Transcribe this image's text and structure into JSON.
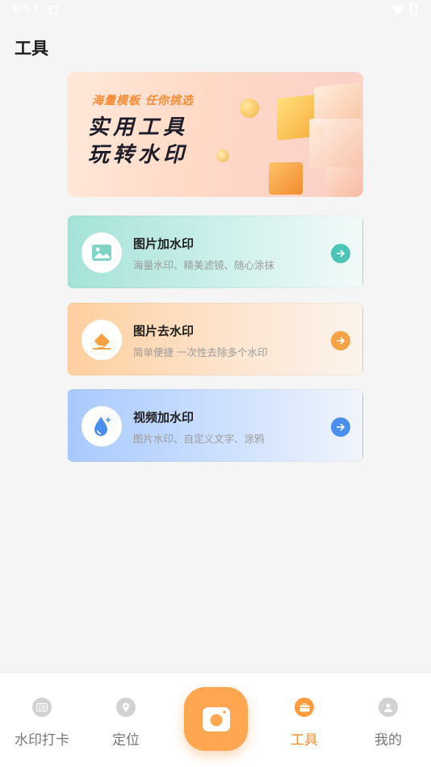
{
  "status_bar": {
    "time": "8:53"
  },
  "page": {
    "title": "工具"
  },
  "banner": {
    "subtitle": "海量模板 任你挑选",
    "line1": "实用工具",
    "line2": "玩转水印"
  },
  "tools": [
    {
      "title": "图片加水印",
      "desc": "海量水印、精美滤镜、随心涂抹",
      "accent": "#4cc5b6",
      "icon": "image-icon"
    },
    {
      "title": "图片去水印",
      "desc": "简单便捷 一次性去除多个水印",
      "accent": "#f5a244",
      "icon": "eraser-icon"
    },
    {
      "title": "视频加水印",
      "desc": "图片水印、自定义文字、涂鸦",
      "accent": "#4a8ff0",
      "icon": "water-drop-icon"
    }
  ],
  "tabbar": {
    "items": [
      {
        "label": "水印打卡",
        "icon": "watermark-stamp-icon",
        "active": false
      },
      {
        "label": "定位",
        "icon": "location-pin-icon",
        "active": false
      },
      {
        "label": "工具",
        "icon": "toolbox-icon",
        "active": true
      },
      {
        "label": "我的",
        "icon": "person-icon",
        "active": false
      }
    ],
    "center_icon": "camera-icon"
  },
  "colors": {
    "accent": "#ff9c3f",
    "background": "#f5f5f5"
  }
}
